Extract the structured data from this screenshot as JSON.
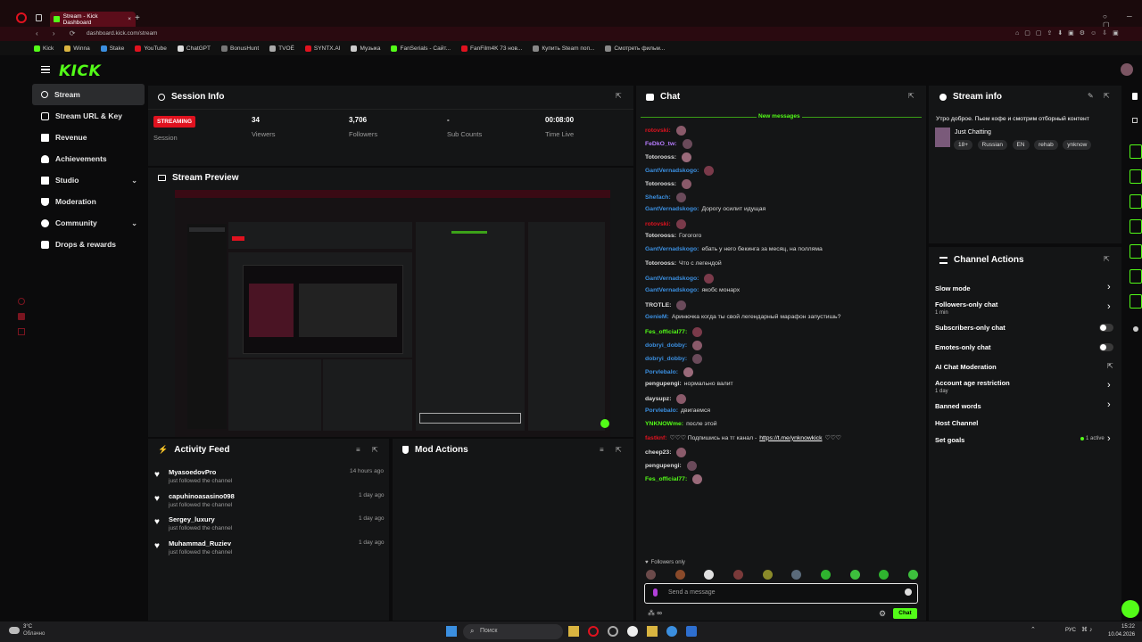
{
  "browser": {
    "tab_title": "Stream - Kick Dashboard",
    "url": "dashboard.kick.com/stream",
    "bookmarks": [
      "Kick",
      "Winna",
      "Stake",
      "YouTube",
      "ChatGPT",
      "BonusHunt",
      "TVOЁ",
      "SYNTX.AI",
      "Музыка",
      "FanSerials - Сайт...",
      "FanFilm4K 73 нов...",
      "Купить Steam поп...",
      "Смотреть фильм..."
    ]
  },
  "app": {
    "logo": "KICK"
  },
  "sidebar": {
    "items": [
      {
        "label": "Stream",
        "icon": "stream-icon"
      },
      {
        "label": "Stream URL & Key",
        "icon": "key-icon"
      },
      {
        "label": "Revenue",
        "icon": "revenue-icon"
      },
      {
        "label": "Achievements",
        "icon": "trophy-icon"
      },
      {
        "label": "Studio",
        "icon": "studio-icon"
      },
      {
        "label": "Moderation",
        "icon": "moderation-icon"
      },
      {
        "label": "Community",
        "icon": "community-icon"
      },
      {
        "label": "Drops & rewards",
        "icon": "drops-icon"
      }
    ]
  },
  "session": {
    "title": "Session Info",
    "badge": "STREAMING",
    "session_label": "Session",
    "viewers": "34",
    "viewers_label": "Viewers",
    "followers": "3,706",
    "followers_label": "Followers",
    "subs": "-",
    "subs_label": "Sub Counts",
    "time": "00:08:00",
    "time_label": "Time Live"
  },
  "preview": {
    "title": "Stream Preview"
  },
  "activity": {
    "title": "Activity Feed",
    "items": [
      {
        "name": "MyasoedovPro",
        "sub": "just followed the channel",
        "time": "14 hours ago"
      },
      {
        "name": "capuhinoasasino098",
        "sub": "just followed the channel",
        "time": "1 day ago"
      },
      {
        "name": "Sergey_luxury",
        "sub": "just followed the channel",
        "time": "1 day ago"
      },
      {
        "name": "Muhammad_Ruziev",
        "sub": "just followed the channel",
        "time": "1 day ago"
      }
    ]
  },
  "mod_actions": {
    "title": "Mod Actions"
  },
  "chat": {
    "title": "Chat",
    "new_messages": "New messages",
    "messages": [
      {
        "user": "rotovski:",
        "color": "#e0121f",
        "text": ""
      },
      {
        "user": "FeDkO_tw:",
        "color": "#b77cff",
        "text": ""
      },
      {
        "user": "Totorooss:",
        "color": "#dcdcdc",
        "text": ""
      },
      {
        "user": "GantVernadskogo:",
        "color": "#3b8fe0",
        "text": ""
      },
      {
        "user": "Totorooss:",
        "color": "#dcdcdc",
        "text": ""
      },
      {
        "user": "Shefach:",
        "color": "#3b8fe0",
        "text": ""
      },
      {
        "user": "GantVernadskogo:",
        "color": "#3b8fe0",
        "text": "Дорогу осилит идущая"
      },
      {
        "user": "rotovski:",
        "color": "#e0121f",
        "text": ""
      },
      {
        "user": "Totorooss:",
        "color": "#dcdcdc",
        "text": "Гогогого"
      },
      {
        "user": "GantVernadskogo:",
        "color": "#3b8fe0",
        "text": "ебать у него бекинга за месяц, на поллямa"
      },
      {
        "user": "Totorooss:",
        "color": "#dcdcdc",
        "text": "Что с легендой"
      },
      {
        "user": "GantVernadskogo:",
        "color": "#3b8fe0",
        "text": ""
      },
      {
        "user": "GantVernadskogo:",
        "color": "#3b8fe0",
        "text": "якобс монарх"
      },
      {
        "user": "TROTLE:",
        "color": "#dcdcdc",
        "text": ""
      },
      {
        "user": "GenieM:",
        "color": "#3b8fe0",
        "text": "Аринючка когда ты свой легендарный марафон запустишь?"
      },
      {
        "user": "Fes_official77:",
        "color": "#53fc18",
        "text": ""
      },
      {
        "user": "dobryi_dobby:",
        "color": "#3b8fe0",
        "text": ""
      },
      {
        "user": "dobryi_dobby:",
        "color": "#3b8fe0",
        "text": ""
      },
      {
        "user": "Porvlebalo:",
        "color": "#3b8fe0",
        "text": ""
      },
      {
        "user": "pengupengi:",
        "color": "#dcdcdc",
        "text": "нормально валит"
      },
      {
        "user": "daysupz:",
        "color": "#dcdcdc",
        "text": ""
      },
      {
        "user": "Porvlebalo:",
        "color": "#3b8fe0",
        "text": "двигаемся"
      },
      {
        "user": "YNKNOWme:",
        "color": "#53fc18",
        "text": "после этой"
      },
      {
        "user": "fastknf:",
        "color": "#e0121f",
        "text": "♡♡♡ Подпишись на тг канал -",
        "link": "https://t.me/ynknowkick",
        "tail": "♡♡♡"
      },
      {
        "user": "cheep23:",
        "color": "#dcdcdc",
        "text": ""
      },
      {
        "user": "pengupengi:",
        "color": "#dcdcdc",
        "text": ""
      },
      {
        "user": "Fes_official77:",
        "color": "#53fc18",
        "text": ""
      }
    ],
    "followers_only": "Followers only",
    "placeholder": "Send a message",
    "send_label": "Chat"
  },
  "stream_info": {
    "title": "Stream info",
    "headline": "Утро доброе. Пьем кофе и смотрим отборный контент",
    "category": "Just Chatting",
    "tags": [
      "18+",
      "Russian",
      "EN",
      "rehab",
      "ynknow"
    ]
  },
  "channel_actions": {
    "title": "Channel Actions",
    "items": [
      {
        "label": "Slow mode",
        "sub": "",
        "control": "chevron"
      },
      {
        "label": "Followers-only chat",
        "sub": "1 min",
        "control": "chevron"
      },
      {
        "label": "Subscribers-only chat",
        "sub": "",
        "control": "toggle"
      },
      {
        "label": "Emotes-only chat",
        "sub": "",
        "control": "toggle"
      },
      {
        "label": "AI Chat Moderation",
        "sub": "",
        "control": "external"
      },
      {
        "label": "Account age restriction",
        "sub": "1 day",
        "control": "chevron"
      },
      {
        "label": "Banned words",
        "sub": "",
        "control": "chevron"
      },
      {
        "label": "Host Channel",
        "sub": "",
        "control": "none"
      },
      {
        "label": "Set goals",
        "sub": "",
        "control": "chevron",
        "status": "1 active"
      }
    ]
  },
  "taskbar": {
    "weather_temp": "3°C",
    "weather_desc": "Облачно",
    "search": "Поиск",
    "lang": "РУС",
    "time": "15:22",
    "date": "10.04.2026"
  },
  "colors": {
    "accent": "#53fc18",
    "live": "#e0121f",
    "panel": "#141516",
    "bg": "#0b0b0c"
  }
}
